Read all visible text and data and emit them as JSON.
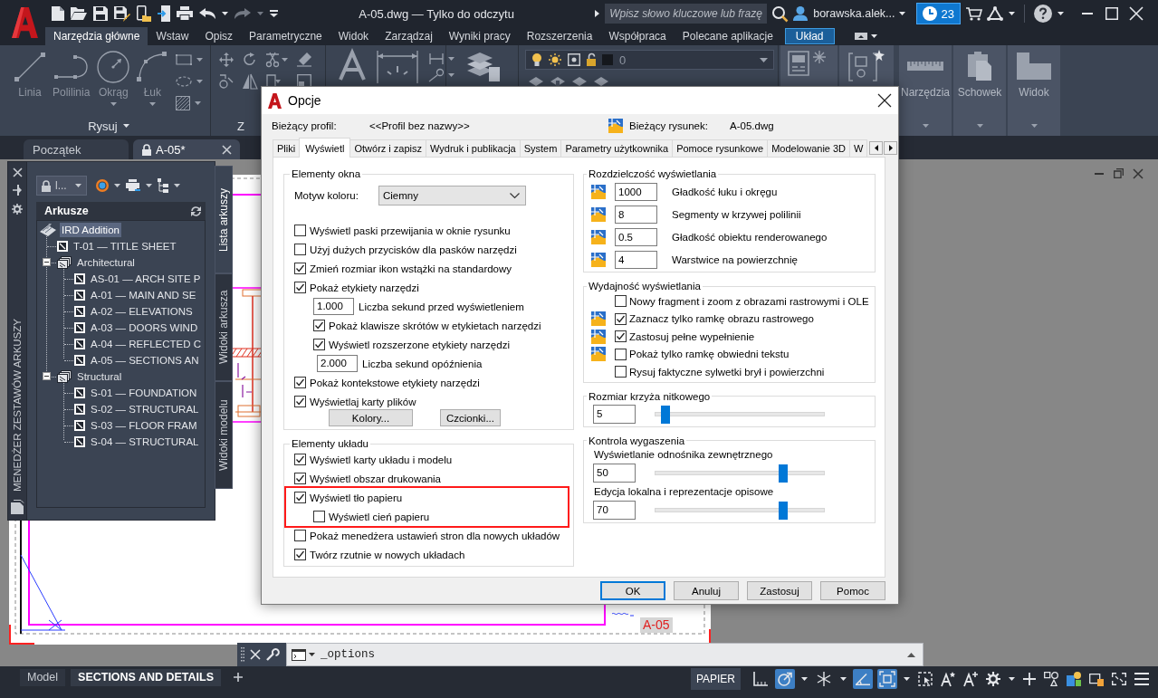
{
  "app_bar": {
    "title": "A-05.dwg — Tylko do odczytu",
    "search": {
      "placeholder": "Wpisz słowo kluczowe lub frazę"
    },
    "user": "borawska.alek...",
    "notifications": "23"
  },
  "ribbon": {
    "tabs": [
      {
        "label": "Narzędzia główne",
        "selected": true,
        "kind": "standard"
      },
      {
        "label": "Wstaw",
        "selected": false,
        "kind": "standard"
      },
      {
        "label": "Opisz",
        "selected": false,
        "kind": "standard"
      },
      {
        "label": "Parametryczne",
        "selected": false,
        "kind": "standard"
      },
      {
        "label": "Widok",
        "selected": false,
        "kind": "standard"
      },
      {
        "label": "Zarządzaj",
        "selected": false,
        "kind": "standard"
      },
      {
        "label": "Wyniki pracy",
        "selected": false,
        "kind": "standard"
      },
      {
        "label": "Rozszerzenia",
        "selected": false,
        "kind": "standard"
      },
      {
        "label": "Współpraca",
        "selected": false,
        "kind": "standard"
      },
      {
        "label": "Polecane aplikacje",
        "selected": false,
        "kind": "standard"
      },
      {
        "label": "Układ",
        "selected": false,
        "kind": "contextual"
      }
    ],
    "panels": [
      {
        "kind": "draw",
        "title": "Rysuj",
        "tools": [
          {
            "label": "Linia",
            "dropdown": false
          },
          {
            "label": "Polilinia",
            "dropdown": false
          },
          {
            "label": "Okrąg",
            "dropdown": true
          },
          {
            "label": "Łuk",
            "dropdown": true
          }
        ]
      },
      {
        "kind": "modify",
        "title": "Z"
      },
      {
        "kind": "annotation"
      },
      {
        "kind": "layer_properties"
      },
      {
        "kind": "layers",
        "layer": "0"
      },
      {
        "kind": "block"
      },
      {
        "kind": "groups"
      },
      {
        "kind": "tool",
        "title": "Narzędzia"
      },
      {
        "kind": "tool",
        "title": "Schowek"
      },
      {
        "kind": "tool",
        "title": "Widok"
      }
    ]
  },
  "file_tabs": [
    {
      "label": "Początek",
      "selected": false,
      "locked": false
    },
    {
      "label": "A-05*",
      "selected": true,
      "locked": true
    }
  ],
  "sheet_set_manager": {
    "title": "MENEDŻER ZESTAWÓW ARKUSZY",
    "view_selector": "l...",
    "list_header": "Arkusze",
    "tree": [
      {
        "label": "IRD Addition",
        "kind": "sheet_set",
        "selected": true,
        "children": [
          {
            "label": "T-01 — TITLE SHEET",
            "kind": "sheet",
            "selected": false
          },
          {
            "label": "Architectural",
            "kind": "subset",
            "selected": false,
            "expanded": true,
            "children": [
              {
                "label": "AS-01 — ARCH SITE P",
                "kind": "sheet",
                "selected": false
              },
              {
                "label": "A-01 — MAIN AND SE",
                "kind": "sheet",
                "selected": false
              },
              {
                "label": "A-02 — ELEVATIONS",
                "kind": "sheet",
                "selected": false
              },
              {
                "label": "A-03 — DOORS WIND",
                "kind": "sheet",
                "selected": false
              },
              {
                "label": "A-04 — REFLECTED C",
                "kind": "sheet",
                "selected": false
              },
              {
                "label": "A-05 — SECTIONS AN",
                "kind": "sheet",
                "selected": false
              }
            ]
          },
          {
            "label": "Structural",
            "kind": "subset",
            "selected": false,
            "expanded": true,
            "children": [
              {
                "label": "S-01 — FOUNDATION",
                "kind": "sheet",
                "selected": false
              },
              {
                "label": "S-02 — STRUCTURAL",
                "kind": "sheet",
                "selected": false
              },
              {
                "label": "S-03 — FLOOR FRAM",
                "kind": "sheet",
                "selected": false
              },
              {
                "label": "S-04 — STRUCTURAL",
                "kind": "sheet",
                "selected": false
              }
            ]
          }
        ]
      }
    ],
    "side_tabs": [
      {
        "label": "Lista arkuszy",
        "selected": true
      },
      {
        "label": "Widoki arkusza",
        "selected": false
      },
      {
        "label": "Widoki modelu",
        "selected": false
      }
    ]
  },
  "drawing": {
    "sheet_label": "A-05"
  },
  "options_dialog": {
    "title": "Opcje",
    "profile_label": "Bieżący profil:",
    "profile": "<<Profil bez nazwy>>",
    "drawing_label": "Bieżący rysunek:",
    "drawing": "A-05.dwg",
    "tabs": [
      {
        "label": "Pliki",
        "selected": false
      },
      {
        "label": "Wyświetl",
        "selected": true
      },
      {
        "label": "Otwórz i zapisz",
        "selected": false
      },
      {
        "label": "Wydruk i publikacja",
        "selected": false
      },
      {
        "label": "System",
        "selected": false
      },
      {
        "label": "Parametry użytkownika",
        "selected": false
      },
      {
        "label": "Pomoce rysunkowe",
        "selected": false
      },
      {
        "label": "Modelowanie 3D",
        "selected": false
      },
      {
        "label": "W",
        "selected": false
      }
    ],
    "columns": [
      {
        "groups": [
          {
            "title": "Elementy okna",
            "items": [
              {
                "kind": "select",
                "label": "Motyw koloru:",
                "value": "Ciemny"
              },
              {
                "kind": "checkbox",
                "label": "Wyświetl paski przewijania w oknie rysunku",
                "checked": false
              },
              {
                "kind": "checkbox",
                "label": "Użyj dużych przycisków dla pasków narzędzi",
                "checked": false
              },
              {
                "kind": "checkbox",
                "label": "Zmień rozmiar ikon wstążki na standardowy",
                "checked": true
              },
              {
                "kind": "checkbox",
                "label": "Pokaż etykiety narzędzi",
                "checked": true,
                "children": [
                  {
                    "kind": "number",
                    "value": "1.000",
                    "label": "Liczba sekund przed wyświetleniem"
                  },
                  {
                    "kind": "checkbox",
                    "label": "Pokaż klawisze skrótów w etykietach narzędzi",
                    "checked": true
                  },
                  {
                    "kind": "checkbox",
                    "label": "Wyświetl rozszerzone etykiety narzędzi",
                    "checked": true,
                    "children": [
                      {
                        "kind": "number",
                        "value": "2.000",
                        "label": "Liczba sekund opóźnienia"
                      }
                    ]
                  }
                ]
              },
              {
                "kind": "checkbox",
                "label": "Pokaż kontekstowe etykiety narzędzi",
                "checked": true
              },
              {
                "kind": "checkbox",
                "label": "Wyświetlaj karty plików",
                "checked": true
              },
              {
                "kind": "buttons",
                "buttons": [
                  "Kolory...",
                  "Czcionki..."
                ]
              }
            ]
          },
          {
            "title": "Elementy układu",
            "items": [
              {
                "kind": "checkbox",
                "label": "Wyświetl karty układu i modelu",
                "checked": true
              },
              {
                "kind": "checkbox",
                "label": "Wyświetl obszar drukowania",
                "checked": true
              },
              {
                "kind": "checkbox",
                "label": "Wyświetl tło papieru",
                "checked": true,
                "highlighted": true,
                "children": [
                  {
                    "kind": "checkbox",
                    "label": "Wyświetl cień papieru",
                    "checked": false
                  }
                ]
              },
              {
                "kind": "checkbox",
                "label": "Pokaż menedżera ustawień stron dla nowych układów",
                "checked": false
              },
              {
                "kind": "checkbox",
                "label": "Twórz rzutnie w nowych układach",
                "checked": true
              }
            ]
          }
        ]
      },
      {
        "groups": [
          {
            "title": "Rozdzielczość wyświetlania",
            "items": [
              {
                "kind": "number",
                "value": "1000",
                "label": "Gładkość łuku i okręgu",
                "drawing_setting": true
              },
              {
                "kind": "number",
                "value": "8",
                "label": "Segmenty w krzywej polilinii",
                "drawing_setting": true
              },
              {
                "kind": "number",
                "value": "0.5",
                "label": "Gładkość obiektu renderowanego",
                "drawing_setting": true
              },
              {
                "kind": "number",
                "value": "4",
                "label": "Warstwice na powierzchnię",
                "drawing_setting": true
              }
            ]
          },
          {
            "title": "Wydajność wyświetlania",
            "items": [
              {
                "kind": "checkbox",
                "label": "Nowy fragment i zoom z obrazami rastrowymi i OLE",
                "checked": false,
                "drawing_setting": false
              },
              {
                "kind": "checkbox",
                "label": "Zaznacz tylko ramkę obrazu rastrowego",
                "checked": true,
                "drawing_setting": true
              },
              {
                "kind": "checkbox",
                "label": "Zastosuj pełne wypełnienie",
                "checked": true,
                "drawing_setting": true
              },
              {
                "kind": "checkbox",
                "label": "Pokaż tylko ramkę obwiedni tekstu",
                "checked": false,
                "drawing_setting": true
              },
              {
                "kind": "checkbox",
                "label": "Rysuj faktyczne sylwetki brył i powierzchni",
                "checked": false,
                "drawing_setting": false
              }
            ]
          },
          {
            "title": "Rozmiar krzyża nitkowego",
            "items": [
              {
                "kind": "slider",
                "value": "5",
                "level": 0.06
              }
            ]
          },
          {
            "title": "Kontrola wygaszenia",
            "items": [
              {
                "kind": "slider",
                "label": "Wyświetlanie odnośnika zewnętrznego",
                "value": "50",
                "level": 0.76
              },
              {
                "kind": "slider",
                "label": "Edycja lokalna i reprezentacje opisowe",
                "value": "70",
                "level": 0.76
              }
            ]
          }
        ]
      }
    ],
    "buttons": [
      {
        "label": "OK",
        "default": true
      },
      {
        "label": "Anuluj",
        "default": false
      },
      {
        "label": "Zastosuj",
        "default": false
      },
      {
        "label": "Pomoc",
        "default": false
      }
    ]
  },
  "command_line": {
    "value": "_options"
  },
  "layout_tabs": [
    {
      "label": "Model",
      "selected": false
    },
    {
      "label": "SECTIONS AND DETAILS",
      "selected": true
    }
  ],
  "status_bar": {
    "space_button": "PAPIER",
    "toggles": [
      {
        "on": false
      },
      {
        "on": true
      },
      {
        "on": false
      },
      {
        "on": true
      },
      {
        "on": true
      }
    ]
  }
}
